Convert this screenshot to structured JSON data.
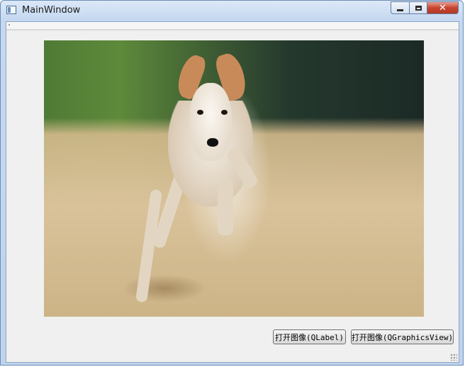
{
  "window": {
    "title": "MainWindow",
    "icon": "app-window-icon"
  },
  "caption_buttons": {
    "minimize_icon": "minimize-icon",
    "maximize_icon": "maximize-icon",
    "close_glyph": "✕"
  },
  "central": {
    "image_content": "running dog photo",
    "buttons": {
      "open_qlabel": "打开图像(QLabel)",
      "open_qgraphicsview": "打开图像(QGraphicsView)"
    }
  },
  "colors": {
    "title_bar": "#c5d8f0",
    "client_background": "#f0f0f0",
    "close_button": "#c7452f"
  }
}
